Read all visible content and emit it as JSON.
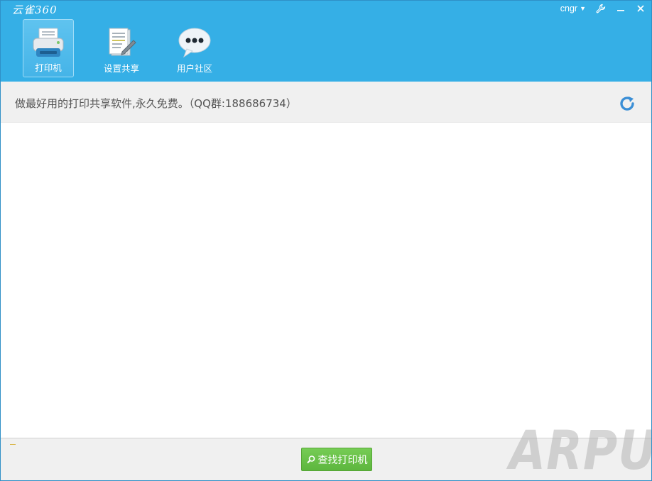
{
  "app": {
    "title": "云雀360"
  },
  "titlebar": {
    "user": "cngr"
  },
  "tabs": [
    {
      "label": "打印机",
      "icon": "printer-icon",
      "active": true
    },
    {
      "label": "设置共享",
      "icon": "share-document-icon",
      "active": false
    },
    {
      "label": "用户社区",
      "icon": "chat-bubble-icon",
      "active": false
    }
  ],
  "info": {
    "text": "做最好用的打印共享软件,永久免费。（QQ群:188686734）"
  },
  "footer": {
    "find_printer_label": "查找打印机"
  },
  "watermark": {
    "text": "ARPUN"
  },
  "colors": {
    "header": "#35afe6",
    "button": "#6cc34c"
  }
}
